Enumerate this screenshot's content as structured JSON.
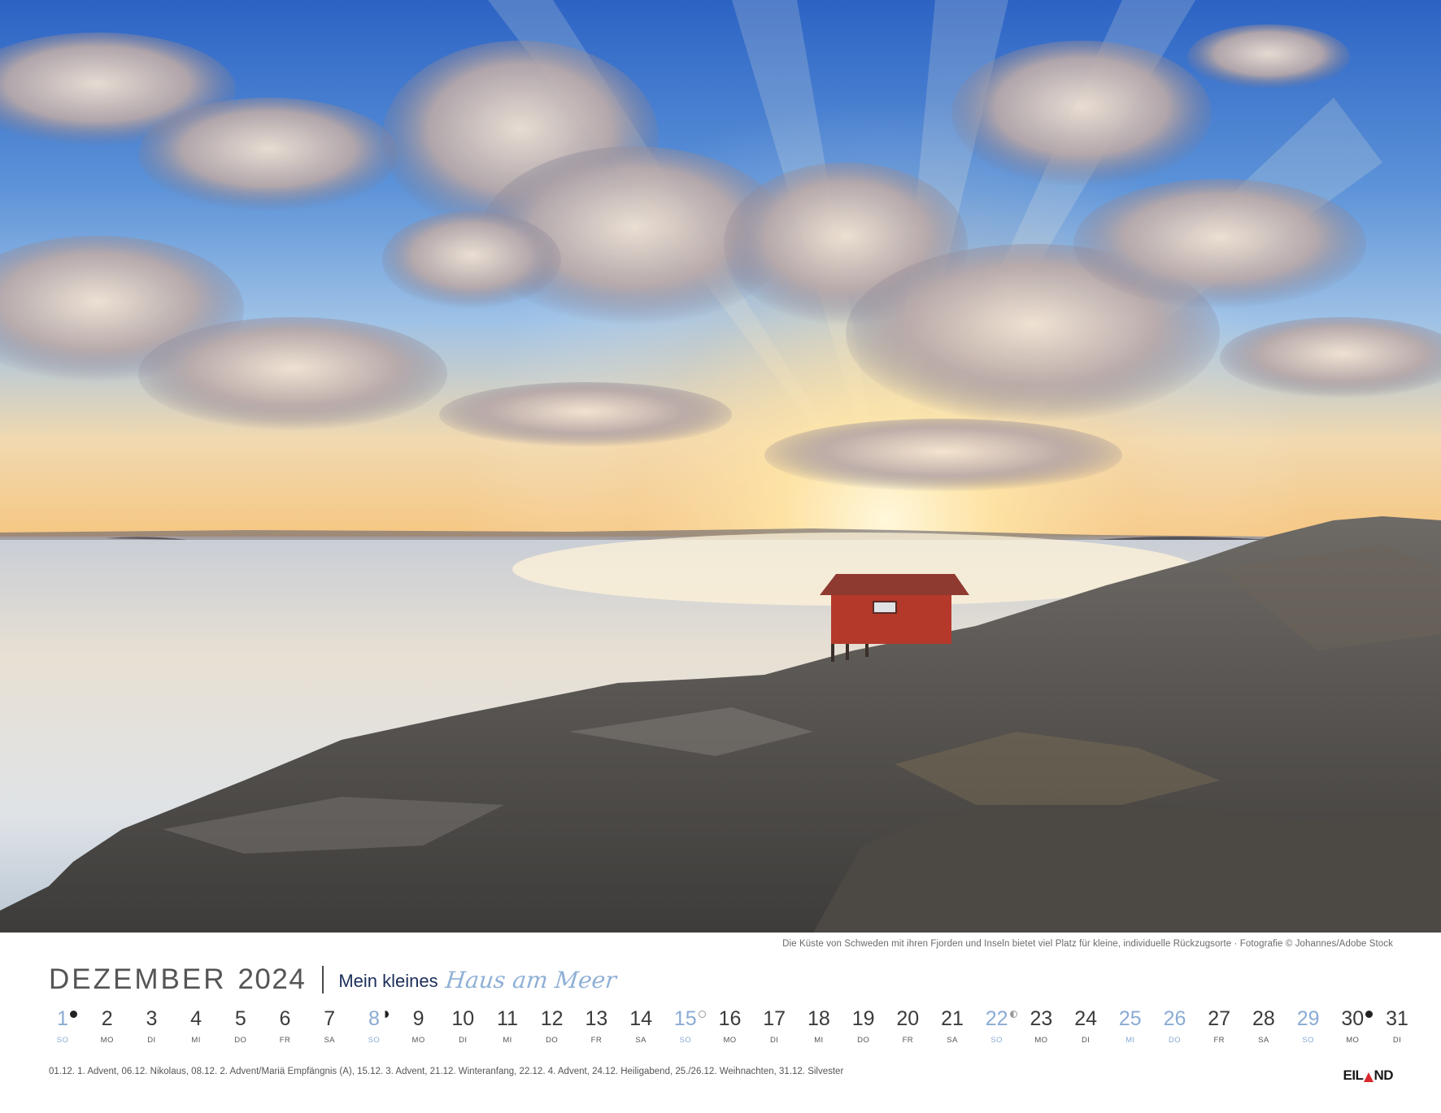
{
  "photo": {
    "subject": "red-boathouse-on-rocky-coast-at-sunset",
    "colors": {
      "sky_top": "#2f6fcf",
      "sky_mid": "#8ab6e3",
      "horizon": "#f7d49a",
      "sun": "#fff6d8",
      "water": "#d6dde3",
      "rock": "#5c5a57",
      "hut": "#b23a2c"
    }
  },
  "caption": "Die Küste von Schweden mit ihren Fjorden und Inseln bietet viel Platz für kleine, individuelle Rückzugsorte · Fotografie © Johannes/Adobe Stock",
  "header": {
    "month": "DEZEMBER",
    "year": "2024",
    "series_plain": "Mein kleines",
    "series_script": "Haus am Meer"
  },
  "days": [
    {
      "num": "1",
      "wd": "SO",
      "type": "sunday",
      "moon": "new"
    },
    {
      "num": "2",
      "wd": "MO",
      "type": ""
    },
    {
      "num": "3",
      "wd": "DI",
      "type": ""
    },
    {
      "num": "4",
      "wd": "MI",
      "type": ""
    },
    {
      "num": "5",
      "wd": "DO",
      "type": ""
    },
    {
      "num": "6",
      "wd": "FR",
      "type": ""
    },
    {
      "num": "7",
      "wd": "SA",
      "type": ""
    },
    {
      "num": "8",
      "wd": "SO",
      "type": "sunday",
      "moon": "half-a"
    },
    {
      "num": "9",
      "wd": "MO",
      "type": ""
    },
    {
      "num": "10",
      "wd": "DI",
      "type": ""
    },
    {
      "num": "11",
      "wd": "MI",
      "type": ""
    },
    {
      "num": "12",
      "wd": "DO",
      "type": ""
    },
    {
      "num": "13",
      "wd": "FR",
      "type": ""
    },
    {
      "num": "14",
      "wd": "SA",
      "type": ""
    },
    {
      "num": "15",
      "wd": "SO",
      "type": "sunday",
      "moon": "full"
    },
    {
      "num": "16",
      "wd": "MO",
      "type": ""
    },
    {
      "num": "17",
      "wd": "DI",
      "type": ""
    },
    {
      "num": "18",
      "wd": "MI",
      "type": ""
    },
    {
      "num": "19",
      "wd": "DO",
      "type": ""
    },
    {
      "num": "20",
      "wd": "FR",
      "type": ""
    },
    {
      "num": "21",
      "wd": "SA",
      "type": ""
    },
    {
      "num": "22",
      "wd": "SO",
      "type": "sunday",
      "moon": "half-b"
    },
    {
      "num": "23",
      "wd": "MO",
      "type": ""
    },
    {
      "num": "24",
      "wd": "DI",
      "type": ""
    },
    {
      "num": "25",
      "wd": "MI",
      "type": "holiday"
    },
    {
      "num": "26",
      "wd": "DO",
      "type": "holiday"
    },
    {
      "num": "27",
      "wd": "FR",
      "type": ""
    },
    {
      "num": "28",
      "wd": "SA",
      "type": ""
    },
    {
      "num": "29",
      "wd": "SO",
      "type": "sunday"
    },
    {
      "num": "30",
      "wd": "MO",
      "type": "",
      "moon": "new"
    },
    {
      "num": "31",
      "wd": "DI",
      "type": ""
    }
  ],
  "holidays_line": "01.12. 1. Advent, 06.12. Nikolaus, 08.12. 2. Advent/Mariä Empfängnis (A), 15.12. 3. Advent, 21.12. Winteranfang, 22.12. 4. Advent, 24.12. Heiligabend, 25./26.12. Weihnachten, 31.12. Silvester",
  "logo": {
    "left": "EIL",
    "right": "ND",
    "accent": "#d9282f"
  }
}
